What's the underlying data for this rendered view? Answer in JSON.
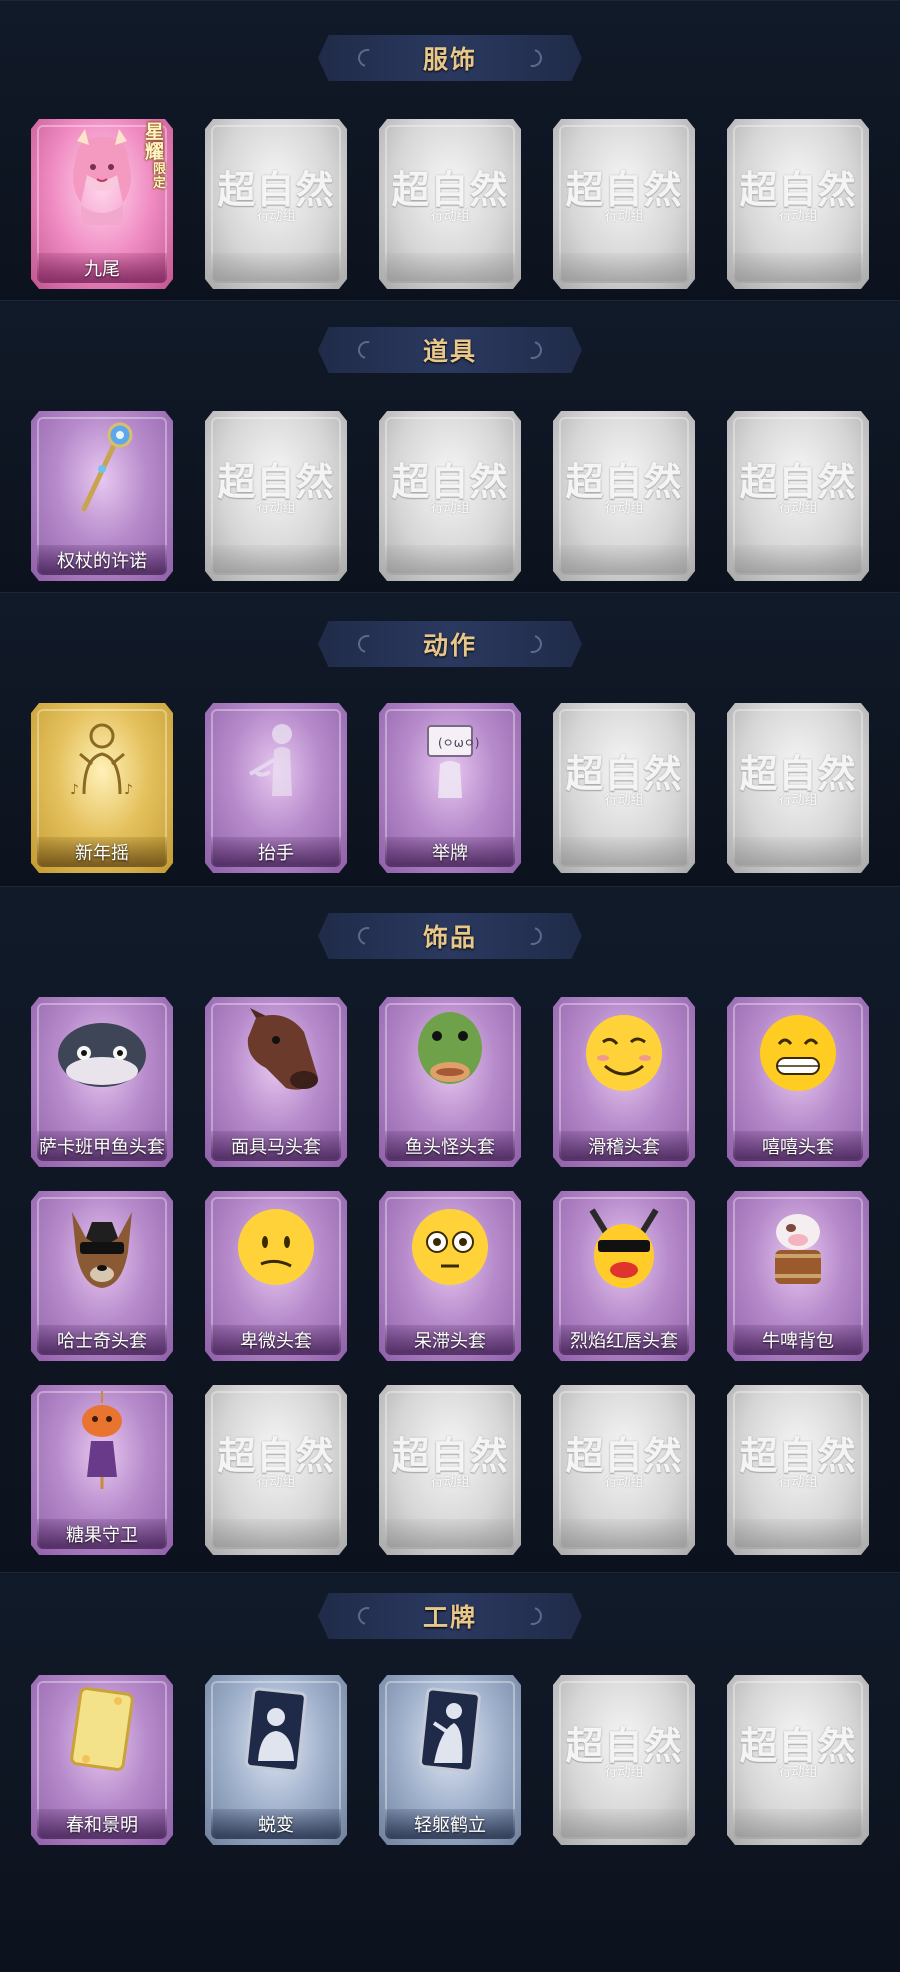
{
  "colors": {
    "background": "#0d1320",
    "section_title": "#e8c78a",
    "header_band": "#2b3960"
  },
  "empty_slot": {
    "title": "超自然",
    "subtitle": "行动组"
  },
  "sections": [
    {
      "title": "服饰",
      "items": [
        {
          "label": "九尾",
          "rarity": "pink",
          "icon": "nine-tail-character-icon",
          "badge": "星耀",
          "badge_small": "限定"
        },
        {
          "empty": true
        },
        {
          "empty": true
        },
        {
          "empty": true
        },
        {
          "empty": true
        }
      ]
    },
    {
      "title": "道具",
      "items": [
        {
          "label": "权杖的许诺",
          "rarity": "purple",
          "icon": "scepter-icon"
        },
        {
          "empty": true
        },
        {
          "empty": true
        },
        {
          "empty": true
        },
        {
          "empty": true
        }
      ]
    },
    {
      "title": "动作",
      "items": [
        {
          "label": "新年摇",
          "rarity": "gold",
          "icon": "dance-pose-icon"
        },
        {
          "label": "抬手",
          "rarity": "purple",
          "icon": "raise-hand-icon"
        },
        {
          "label": "举牌",
          "rarity": "purple",
          "icon": "hold-sign-icon"
        },
        {
          "empty": true
        },
        {
          "empty": true
        }
      ]
    },
    {
      "title": "饰品",
      "items": [
        {
          "label": "萨卡班甲鱼头套",
          "rarity": "purple",
          "icon": "fish-head-icon"
        },
        {
          "label": "面具马头套",
          "rarity": "purple",
          "icon": "horse-mask-icon"
        },
        {
          "label": "鱼头怪头套",
          "rarity": "purple",
          "icon": "fish-monster-mask-icon"
        },
        {
          "label": "滑稽头套",
          "rarity": "purple",
          "icon": "funny-face-mask-icon"
        },
        {
          "label": "嘻嘻头套",
          "rarity": "purple",
          "icon": "grin-face-mask-icon"
        },
        {
          "label": "哈士奇头套",
          "rarity": "purple",
          "icon": "husky-mask-icon"
        },
        {
          "label": "卑微头套",
          "rarity": "purple",
          "icon": "humble-face-mask-icon"
        },
        {
          "label": "呆滞头套",
          "rarity": "purple",
          "icon": "stunned-face-mask-icon"
        },
        {
          "label": "烈焰红唇头套",
          "rarity": "purple",
          "icon": "red-lips-mask-icon"
        },
        {
          "label": "牛啤背包",
          "rarity": "purple",
          "icon": "cow-beer-backpack-icon"
        },
        {
          "label": "糖果守卫",
          "rarity": "purple",
          "icon": "candy-guard-icon"
        },
        {
          "empty": true
        },
        {
          "empty": true
        },
        {
          "empty": true
        },
        {
          "empty": true
        }
      ]
    },
    {
      "title": "工牌",
      "items": [
        {
          "label": "春和景明",
          "rarity": "purple",
          "icon": "golden-badge-icon"
        },
        {
          "label": "蜕变",
          "rarity": "blue",
          "icon": "silhouette-badge-icon"
        },
        {
          "label": "轻躯鹤立",
          "rarity": "blue",
          "icon": "silhouette-pose-badge-icon"
        },
        {
          "empty": true
        },
        {
          "empty": true
        }
      ]
    }
  ]
}
